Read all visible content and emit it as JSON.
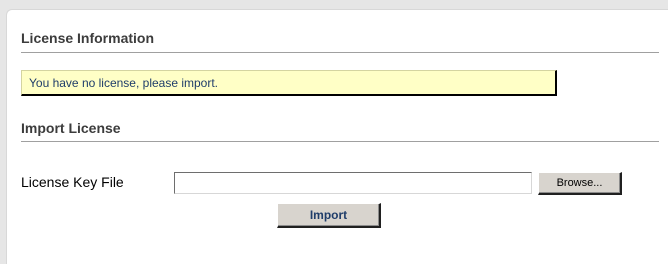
{
  "license_info": {
    "title": "License Information",
    "notice": "You have no license, please import."
  },
  "import_license": {
    "title": "Import License",
    "field_label": "License Key File",
    "file_value": "",
    "browse_label": "Browse...",
    "import_label": "Import"
  }
}
